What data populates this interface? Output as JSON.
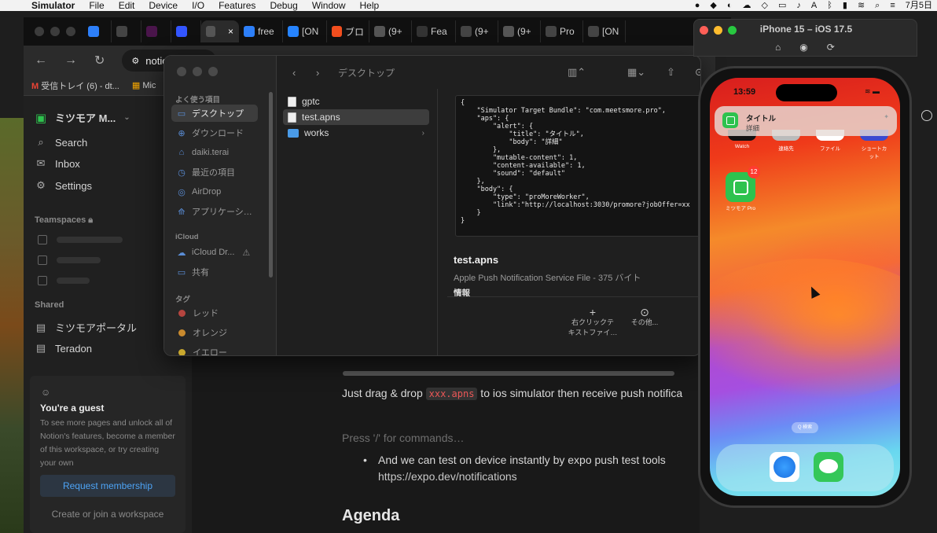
{
  "menubar": {
    "app": "Simulator",
    "items": [
      "File",
      "Edit",
      "Device",
      "I/O",
      "Features",
      "Debug",
      "Window",
      "Help"
    ],
    "date": "7月5日"
  },
  "browser": {
    "tabs": [
      {
        "label": "",
        "icon": "calendar-icon",
        "color": "#2d7ff9"
      },
      {
        "label": "",
        "icon": "github-icon",
        "color": "#444"
      },
      {
        "label": "",
        "icon": "slack-icon",
        "color": "#4a154b"
      },
      {
        "label": "",
        "icon": "feather-icon",
        "color": "#3355ff"
      },
      {
        "label": "",
        "icon": "notion-icon",
        "color": "#555",
        "active": true
      },
      {
        "label": "free",
        "icon": "arrow-icon",
        "color": "#2d7ff9"
      },
      {
        "label": "[ON",
        "icon": "jira-icon",
        "color": "#2684ff"
      },
      {
        "label": "ブロ",
        "icon": "figma-icon",
        "color": "#f24e1e"
      },
      {
        "label": "(9+",
        "icon": "notion-icon",
        "color": "#555"
      },
      {
        "label": "Fea",
        "icon": "arrow-icon",
        "color": "#333"
      },
      {
        "label": "(9+",
        "icon": "chatgpt-icon",
        "color": "#444"
      },
      {
        "label": "(9+",
        "icon": "notion-icon",
        "color": "#555"
      },
      {
        "label": "Pro",
        "icon": "globe-icon",
        "color": "#444"
      },
      {
        "label": "[ON",
        "icon": "chatgpt-icon",
        "color": "#444"
      }
    ],
    "url": "notion.",
    "bookmarks": [
      "受信トレイ (6) - dt...",
      "Mic"
    ]
  },
  "notion": {
    "workspace": "ミツモア M...",
    "nav": [
      "Search",
      "Inbox",
      "Settings"
    ],
    "teamspaces_label": "Teamspaces",
    "shared_label": "Shared",
    "shared_items": [
      "ミツモアポータル",
      "Teradon"
    ],
    "guest": {
      "title": "You're a guest",
      "desc": "To see more pages and unlock all of Notion's features, become a member of this workspace, or try creating your own",
      "request": "Request membership",
      "create": "Create or join a workspace"
    },
    "content": {
      "drag_pre": "Just  drag & drop ",
      "drag_code": "xxx.apns",
      "drag_post": " to ios simulator then receive push notifica",
      "placeholder": "Press '/' for commands…",
      "bullet": "And we can test on device instantly by expo push test tools",
      "link": "https://expo.dev/notifications",
      "heading": "Agenda"
    }
  },
  "finder": {
    "path": "デスクトップ",
    "sidebar": {
      "favorites_label": "よく使う項目",
      "favorites": [
        {
          "label": "デスクトップ",
          "icon": "desktop-icon",
          "selected": true
        },
        {
          "label": "ダウンロード",
          "icon": "download-icon"
        },
        {
          "label": "daiki.terai",
          "icon": "home-icon"
        },
        {
          "label": "最近の項目",
          "icon": "clock-icon"
        },
        {
          "label": "AirDrop",
          "icon": "airdrop-icon"
        },
        {
          "label": "アプリケーシ…",
          "icon": "apps-icon"
        }
      ],
      "icloud_label": "iCloud",
      "icloud": [
        {
          "label": "iCloud Dr...",
          "icon": "cloud-icon"
        },
        {
          "label": "共有",
          "icon": "shared-folder-icon"
        }
      ],
      "tags_label": "タグ",
      "tags": [
        {
          "label": "レッド",
          "color": "#b5453f"
        },
        {
          "label": "オレンジ",
          "color": "#c98a2e"
        },
        {
          "label": "イエロー",
          "color": "#c9a82e"
        }
      ]
    },
    "files": [
      {
        "name": "gptc",
        "type": "file"
      },
      {
        "name": "test.apns",
        "type": "file",
        "selected": true
      },
      {
        "name": "works",
        "type": "folder"
      }
    ],
    "preview": {
      "json": "{\n    \"Simulator Target Bundle\": \"com.meetsmore.pro\",\n    \"aps\": {\n        \"alert\": {\n            \"title\": \"タイトル\",\n            \"body\": \"詳細\"\n        },\n        \"mutable-content\": 1,\n        \"content-available\": 1,\n        \"sound\": \"default\"\n    },\n    \"body\": {\n        \"type\": \"proMoreWorker\",\n        \"link\":\"http://localhost:3030/promore?jobOffer=xx\n    }\n}",
      "name": "test.apns",
      "type": "Apple Push Notification Service File - 375 バイト",
      "info": "情報",
      "action1_line1": "右クリックテ",
      "action1_line2": "キストファイ…",
      "action2": "その他..."
    }
  },
  "simulator": {
    "title": "iPhone 15 – iOS 17.5",
    "time": "13:59",
    "notification": {
      "title": "タイトル",
      "body": "詳細"
    },
    "top_icons": [
      "Watch",
      "連絡先",
      "ファイル",
      "ショートカット"
    ],
    "app_label": "ミツモア Pro",
    "badge": "12",
    "search": "Q 検索"
  }
}
